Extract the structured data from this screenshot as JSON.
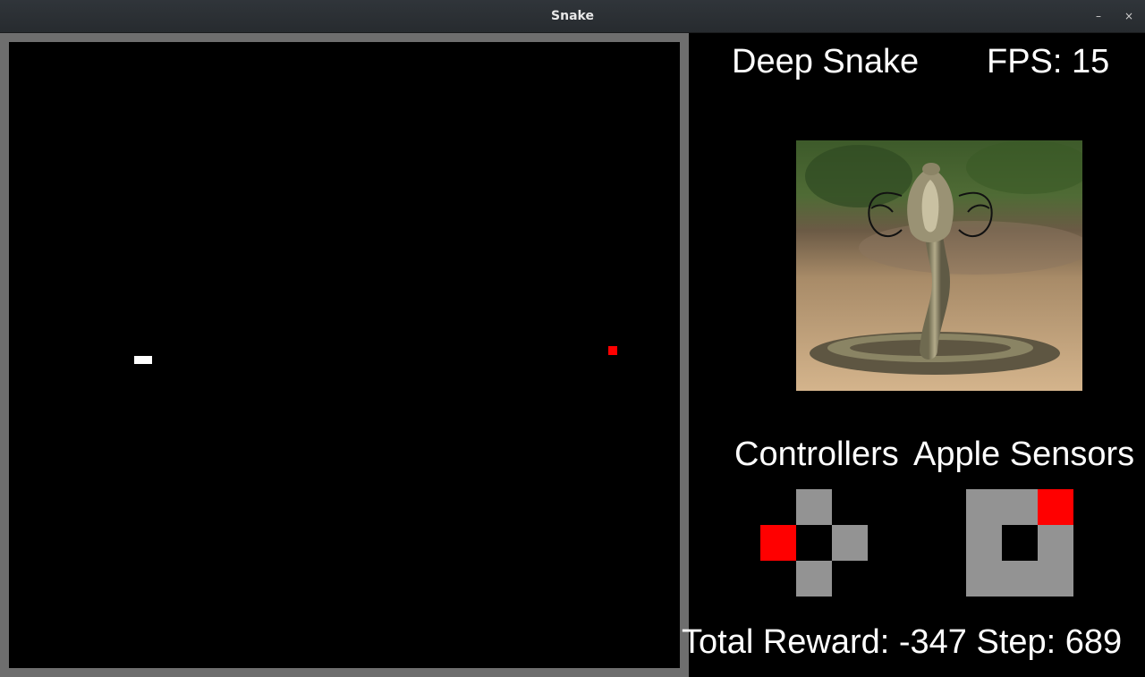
{
  "window": {
    "title": "Snake",
    "minimize_label": "–",
    "close_label": "×"
  },
  "game": {
    "snake_color": "#ffffff",
    "apple_color": "#ff0000",
    "board_color": "#000000",
    "border_color": "#6e6e6e"
  },
  "panel": {
    "app_name": "Deep Snake",
    "fps_label": "FPS:",
    "fps_value": "15",
    "fps_text": "FPS: 15",
    "controllers_title": "Controllers",
    "apple_sensors_title": "Apple Sensors",
    "controllers_grid": [
      [
        "none",
        "gray",
        "none"
      ],
      [
        "red",
        "black",
        "gray"
      ],
      [
        "none",
        "gray",
        "none"
      ]
    ],
    "apple_sensors_grid": [
      [
        "gray",
        "gray",
        "red"
      ],
      [
        "gray",
        "black",
        "gray"
      ],
      [
        "gray",
        "gray",
        "gray"
      ]
    ],
    "cell_colors": {
      "gray": "#939393",
      "red": "#ff0000",
      "black": "#000000",
      "none": "transparent"
    },
    "total_reward_label": "Total Reward:",
    "total_reward": "-347",
    "step_label": "Step:",
    "step": "689",
    "footer_text": "Total Reward: -347 Step: 689"
  }
}
